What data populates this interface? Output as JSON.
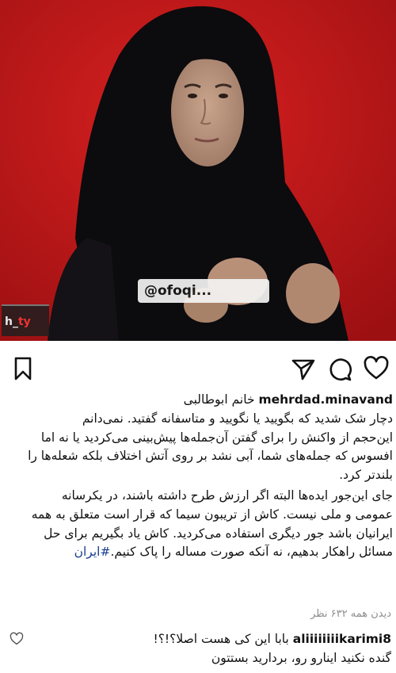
{
  "media": {
    "watermark": "@ofoqi...",
    "channel_logo_main": "h_",
    "channel_logo_accent": "ty"
  },
  "actions": {
    "icons": [
      "bookmark-icon",
      "send-icon",
      "comment-icon",
      "heart-icon"
    ]
  },
  "post": {
    "username": "mehrdad.minavand",
    "caption_lines": [
      "خانم ابوطالبی",
      "دچار شک شدید که بگویید یا نگویید و متاسفانه گفتید. نمی‌دانم",
      "این‌حجم از واکنش را برای گفتن آن‌جمله‌ها پیش‌بینی می‌کردید یا نه اما",
      "افسوس که جمله‌های شما، آبی نشد بر روی آتش اختلاف بلکه شعله‌ها را",
      "بلندتر کرد.",
      "جای این‌جور ایده‌ها البته اگر ارزش طرح داشته باشند، در یکرسانه",
      "عمومی و ملی نیست. کاش از تریبون سیما که قرار است متعلق به همه",
      "ایرانیان باشد جور دیگری استفاده می‌کردید. کاش یاد بگیریم برای حل",
      "مسائل راهکار بدهیم، نه آنکه صورت مساله را پاک کنیم."
    ],
    "hashtag": "#ایران",
    "views": "دیدن همه ۶۳۲ نظر"
  },
  "comment": {
    "username": "aliiiiiiiikarimi8",
    "line1": "بابا این کی هست اصلا؟!؟!",
    "line2": "گنده نکنید اینارو رو، بردارید بستتون"
  },
  "colors": {
    "background_red": "#c8181a",
    "hashtag_blue": "#1a3d8f",
    "muted_gray": "#8e8e8e"
  }
}
